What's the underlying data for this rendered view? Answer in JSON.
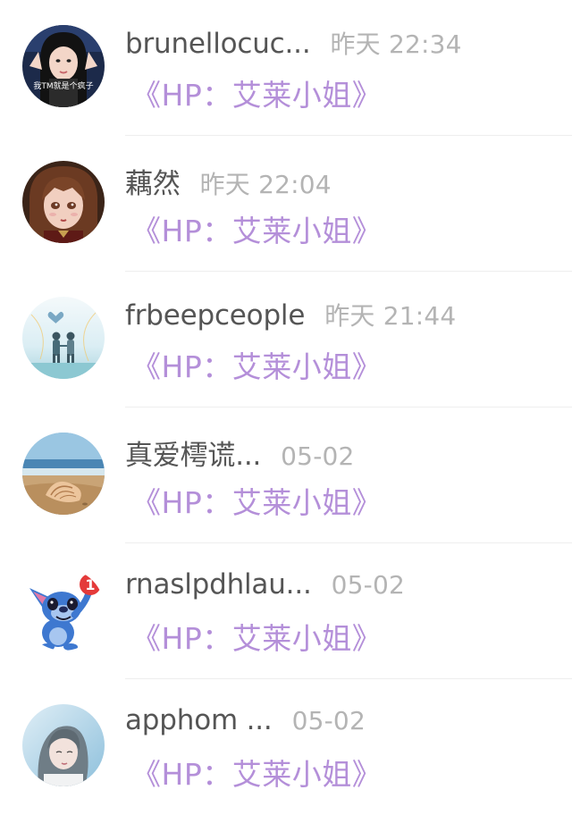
{
  "feed": {
    "items": [
      {
        "name": "brunellocuc...",
        "time": "昨天 22:34",
        "title": "《HP：艾莱小姐》",
        "avatar": "avatar-girl-photo-icon"
      },
      {
        "name": "藕然",
        "time": "昨天 22:04",
        "title": "《HP：艾莱小姐》",
        "avatar": "avatar-anime-girl-icon"
      },
      {
        "name": "frbeepceople",
        "time": "昨天 21:44",
        "title": "《HP：艾莱小姐》",
        "avatar": "avatar-couple-sky-icon"
      },
      {
        "name": "真爱樗谎...",
        "time": "05-02",
        "title": "《HP：艾莱小姐》",
        "avatar": "avatar-beach-shell-icon"
      },
      {
        "name": "rnaslpdhlau...",
        "time": "05-02",
        "title": "《HP：艾莱小姐》",
        "avatar": "avatar-stitch-icon"
      },
      {
        "name": "apphom ...",
        "time": "05-02",
        "title": "《HP：艾莱小姐》",
        "avatar": "avatar-girl-blue-icon"
      }
    ],
    "avatar_texts": {
      "girl_photo_caption": "我TM就是个疯子"
    },
    "badge_count": "1",
    "colors": {
      "name": "#555555",
      "time": "#b4b4b4",
      "title": "#b48fd9",
      "divider": "#eeeeee"
    }
  }
}
